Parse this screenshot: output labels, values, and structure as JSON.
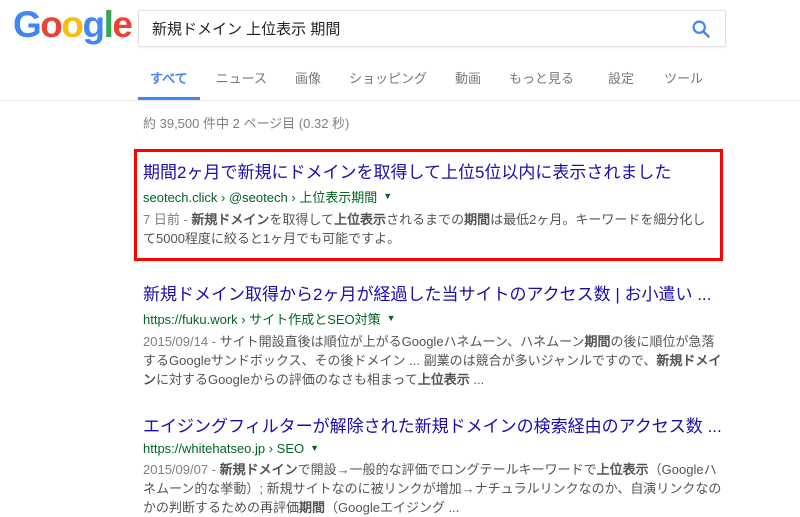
{
  "header": {
    "logo_letters": [
      {
        "ch": "G",
        "color": "#4285F4"
      },
      {
        "ch": "o",
        "color": "#EA4335"
      },
      {
        "ch": "o",
        "color": "#FBBC05"
      },
      {
        "ch": "g",
        "color": "#4285F4"
      },
      {
        "ch": "l",
        "color": "#34A853"
      },
      {
        "ch": "e",
        "color": "#EA4335"
      }
    ],
    "search": {
      "query": "新規ドメイン 上位表示 期間"
    }
  },
  "tabs": {
    "left": [
      {
        "id": "all",
        "label": "すべて",
        "active": true
      },
      {
        "id": "news",
        "label": "ニュース",
        "active": false
      },
      {
        "id": "images",
        "label": "画像",
        "active": false
      },
      {
        "id": "shopping",
        "label": "ショッピング",
        "active": false
      },
      {
        "id": "videos",
        "label": "動画",
        "active": false
      },
      {
        "id": "more",
        "label": "もっと見る",
        "active": false
      }
    ],
    "right": [
      {
        "id": "settings",
        "label": "設定"
      },
      {
        "id": "tools",
        "label": "ツール"
      }
    ]
  },
  "stats": {
    "text": "約 39,500 件中 2 ページ目 (0.32 秒)"
  },
  "colors": {
    "accent_blue": "#4285f4",
    "link_blue": "#1a0dab",
    "url_green": "#006621",
    "snippet_gray": "#545454",
    "highlight_red": "#ff0000"
  },
  "results": [
    {
      "highlighted": true,
      "title": "期間2ヶ月で新規にドメインを取得して上位5位以内に表示されました",
      "breadcrumb": "seotech.click › @seotech › 上位表示期間",
      "date": "7 日前 - ",
      "snippet_segments": [
        {
          "text": "新規ドメイン",
          "bold": true
        },
        {
          "text": "を取得して",
          "bold": false
        },
        {
          "text": "上位表示",
          "bold": true
        },
        {
          "text": "されるまでの",
          "bold": false
        },
        {
          "text": "期間",
          "bold": true
        },
        {
          "text": "は最低2ヶ月。キーワードを細分化して5000程度に絞ると1ヶ月でも可能ですよ。",
          "bold": false
        }
      ]
    },
    {
      "highlighted": false,
      "title": "新規ドメイン取得から2ヶ月が経過した当サイトのアクセス数 | お小遣い ...",
      "breadcrumb": "https://fuku.work › サイト作成とSEO対策",
      "date": "2015/09/14 - ",
      "snippet_segments": [
        {
          "text": "サイト開設直後は順位が上がるGoogleハネムーン、ハネムーン",
          "bold": false
        },
        {
          "text": "期間",
          "bold": true
        },
        {
          "text": "の後に順位が急落するGoogleサンドボックス、その後ドメイン ... 副業のは競合が多いジャンルですので、",
          "bold": false
        },
        {
          "text": "新規ドメイン",
          "bold": true
        },
        {
          "text": "に対するGoogleからの評価のなさも相まって",
          "bold": false
        },
        {
          "text": "上位表示",
          "bold": true
        },
        {
          "text": " ...",
          "bold": false
        }
      ]
    },
    {
      "highlighted": false,
      "title": "エイジングフィルターが解除された新規ドメインの検索経由のアクセス数 ...",
      "breadcrumb": "https://whitehatseo.jp › SEO",
      "date": "2015/09/07 - ",
      "snippet_segments": [
        {
          "text": "新規ドメイン",
          "bold": true
        },
        {
          "text": "で開設→一般的な評価でロングテールキーワードで",
          "bold": false
        },
        {
          "text": "上位表示",
          "bold": true
        },
        {
          "text": "（Googleハネムーン的な挙動）; 新規サイトなのに被リンクが増加→ナチュラルリンクなのか、自演リンクなのかの判断するための再評価",
          "bold": false
        },
        {
          "text": "期間",
          "bold": true
        },
        {
          "text": "（Googleエイジング ...",
          "bold": false
        }
      ]
    }
  ]
}
